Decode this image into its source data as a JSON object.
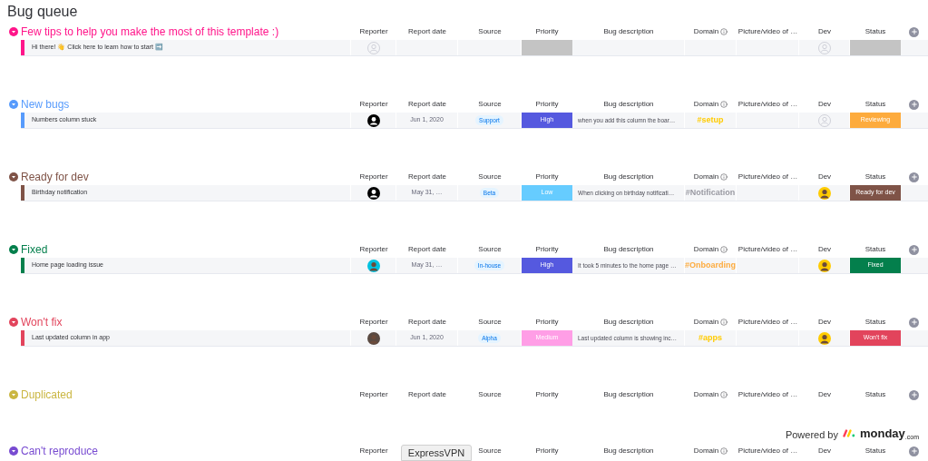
{
  "title": "Bug queue",
  "groups": [
    {
      "title": "Few tips to help you make the most of this template :)",
      "color": "#ff158a",
      "headers": {
        "reporter": "Reporter",
        "report_date": "Report date",
        "source": "Source",
        "priority": "Priority",
        "description": "Bug description",
        "domain": "Domain",
        "picture": "Picture/video of …",
        "dev": "Dev",
        "status": "Status"
      },
      "rows": [
        {
          "name": "Hi there! 👋 Click here to learn how to start ➡️",
          "reporter": {
            "kind": "empty"
          },
          "priority": {
            "color": "#c4c4c4"
          },
          "dev": {
            "kind": "empty"
          },
          "status": {
            "color": "#c4c4c4"
          }
        }
      ]
    },
    {
      "title": "New bugs",
      "color": "#579bfc",
      "headers": {
        "reporter": "Reporter",
        "report_date": "Report date",
        "source": "Source",
        "priority": "Priority",
        "description": "Bug description",
        "domain": "Domain",
        "picture": "Picture/video of …",
        "dev": "Dev",
        "status": "Status"
      },
      "rows": [
        {
          "name": "Numbers column stuck",
          "reporter": {
            "kind": "silhouette"
          },
          "date": "Jun 1, 2020",
          "source": "Support",
          "priority": {
            "label": "High",
            "color": "#5559df"
          },
          "description": "when you add this column the boar…",
          "domain": {
            "label": "#setup",
            "color": "#ffcb00"
          },
          "dev": {
            "kind": "empty"
          },
          "status": {
            "label": "Reviewing",
            "color": "#fdab3d"
          }
        }
      ]
    },
    {
      "title": "Ready for dev",
      "color": "#7f5347",
      "headers": {
        "reporter": "Reporter",
        "report_date": "Report date",
        "source": "Source",
        "priority": "Priority",
        "description": "Bug description",
        "domain": "Domain",
        "picture": "Picture/video of …",
        "dev": "Dev",
        "status": "Status"
      },
      "rows": [
        {
          "name": "Birthday notification",
          "reporter": {
            "kind": "silhouette"
          },
          "date": "May 31, …",
          "source": "Beta",
          "priority": {
            "label": "Low",
            "color": "#66ccff"
          },
          "description": "When clicking on birthday notificati…",
          "domain": {
            "label": "#Notification",
            "color": "#9a9aa2"
          },
          "dev": {
            "kind": "photo",
            "color": "#ffcb00"
          },
          "status": {
            "label": "Ready for dev",
            "color": "#7f5347"
          }
        }
      ]
    },
    {
      "title": "Fixed",
      "color": "#037f4c",
      "headers": {
        "reporter": "Reporter",
        "report_date": "Report date",
        "source": "Source",
        "priority": "Priority",
        "description": "Bug description",
        "domain": "Domain",
        "picture": "Picture/video of …",
        "dev": "Dev",
        "status": "Status"
      },
      "rows": [
        {
          "name": "Home page loading issue",
          "reporter": {
            "kind": "photo",
            "color": "#00c2e0"
          },
          "date": "May 31, …",
          "source": "In-house",
          "priority": {
            "label": "High",
            "color": "#5559df"
          },
          "description": "It took 5 minutes to the home page …",
          "domain": {
            "label": "#Onboarding",
            "color": "#fdab3d"
          },
          "dev": {
            "kind": "photo",
            "color": "#ffcb00"
          },
          "status": {
            "label": "Fixed",
            "color": "#037f4c"
          }
        }
      ]
    },
    {
      "title": "Won't fix",
      "color": "#e2445c",
      "headers": {
        "reporter": "Reporter",
        "report_date": "Report date",
        "source": "Source",
        "priority": "Priority",
        "description": "Bug description",
        "domain": "Domain",
        "picture": "Picture/video of …",
        "dev": "Dev",
        "status": "Status"
      },
      "rows": [
        {
          "name": "Last updated column in app",
          "reporter": {
            "kind": "photo",
            "color": "#5a4a42"
          },
          "date": "Jun 1, 2020",
          "source": "Alpha",
          "priority": {
            "label": "Medium",
            "color": "#ff9ee6"
          },
          "description": "Last updated column is showing inc…",
          "domain": {
            "label": "#apps",
            "color": "#ffcb00"
          },
          "dev": {
            "kind": "photo",
            "color": "#ffcb00"
          },
          "status": {
            "label": "Won't fix",
            "color": "#e2445c"
          }
        }
      ]
    },
    {
      "title": "Duplicated",
      "color": "#cab641",
      "headers": {
        "reporter": "Reporter",
        "report_date": "Report date",
        "source": "Source",
        "priority": "Priority",
        "description": "Bug description",
        "domain": "Domain",
        "picture": "Picture/video of …",
        "dev": "Dev",
        "status": "Status"
      }
    },
    {
      "title": "Can't reproduce",
      "color": "#784bd1",
      "headers": {
        "reporter": "Reporter",
        "source": "Source",
        "priority": "Priority",
        "description": "Bug description",
        "domain": "Domain",
        "picture": "Picture/video of …",
        "dev": "Dev",
        "status": "Status"
      }
    }
  ],
  "vpn_tab": "ExpressVPN",
  "powered_by": {
    "label": "Powered by",
    "brand": "monday",
    "suffix": ".com"
  }
}
